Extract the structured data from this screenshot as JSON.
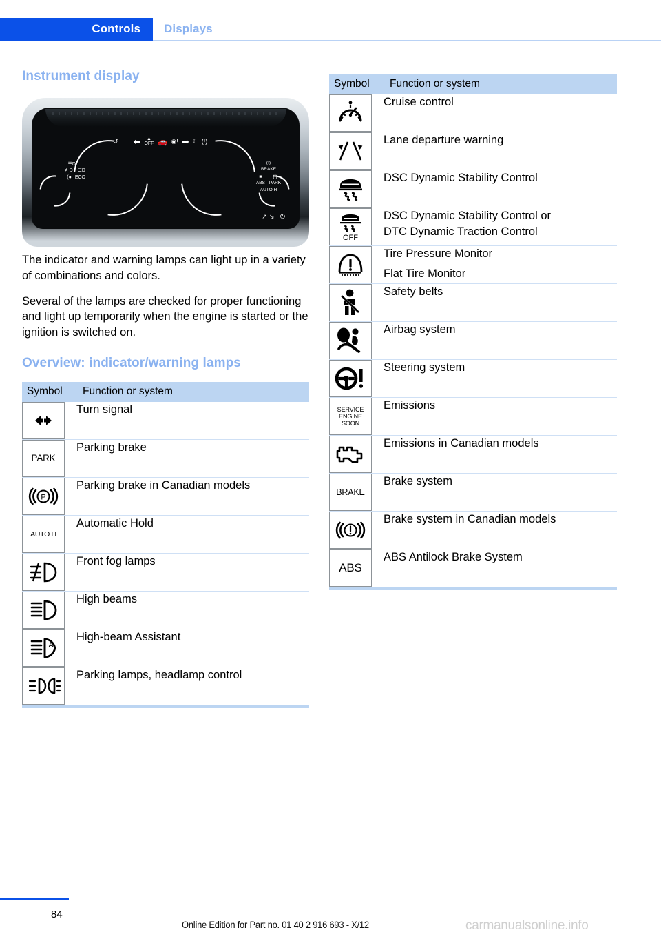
{
  "header": {
    "active_tab": "Controls",
    "inactive_tab": "Displays"
  },
  "left_column": {
    "section_title": "Instrument display",
    "figure_caption": "instrument-cluster-illustration",
    "paragraphs": [
      "The indicator and warning lamps can light up in a variety of combinations and colors.",
      "Several of the lamps are checked for proper functioning and light up temporarily when the engine is started or the ignition is switched on."
    ],
    "overview_title": "Overview: indicator/warning lamps",
    "table": {
      "headers": [
        "Symbol",
        "Function or system"
      ],
      "rows": [
        {
          "icon": "turn-signal-icon",
          "text": "Turn signal"
        },
        {
          "icon": "park-text-icon",
          "icon_text": "PARK",
          "text": "Parking brake"
        },
        {
          "icon": "parking-brake-canada-icon",
          "text": "Parking brake in Canadian models"
        },
        {
          "icon": "auto-hold-icon",
          "icon_text": "AUTO H",
          "text": "Automatic Hold"
        },
        {
          "icon": "front-fog-lamp-icon",
          "text": "Front fog lamps"
        },
        {
          "icon": "high-beam-icon",
          "text": "High beams"
        },
        {
          "icon": "high-beam-assistant-icon",
          "text": "High-beam Assistant"
        },
        {
          "icon": "parking-lamps-icon",
          "text": "Parking lamps, headlamp control"
        }
      ]
    }
  },
  "right_column": {
    "table": {
      "headers": [
        "Symbol",
        "Function or system"
      ],
      "rows": [
        {
          "icon": "cruise-control-icon",
          "text": "Cruise control"
        },
        {
          "icon": "lane-departure-warning-icon",
          "text": "Lane departure warning"
        },
        {
          "icon": "dsc-icon",
          "text": "DSC Dynamic Stability Control"
        },
        {
          "icon": "dsc-off-icon",
          "icon_text": "OFF",
          "text": "DSC Dynamic Stability Control or",
          "text2": "DTC Dynamic Traction Control"
        },
        {
          "icon": "tire-pressure-monitor-icon",
          "text": "Tire Pressure Monitor",
          "text2": "Flat Tire Monitor"
        },
        {
          "icon": "safety-belt-icon",
          "text": "Safety belts"
        },
        {
          "icon": "airbag-icon",
          "text": "Airbag system"
        },
        {
          "icon": "steering-system-icon",
          "text": "Steering system"
        },
        {
          "icon": "service-engine-soon-icon",
          "icon_text": "SERVICE ENGINE SOON",
          "text": "Emissions"
        },
        {
          "icon": "check-engine-icon",
          "text": "Emissions in Canadian models"
        },
        {
          "icon": "brake-text-icon",
          "icon_text": "BRAKE",
          "text": "Brake system"
        },
        {
          "icon": "brake-canada-icon",
          "text": "Brake system in Canadian models"
        },
        {
          "icon": "abs-text-icon",
          "icon_text": "ABS",
          "text": "ABS Antilock Brake System"
        }
      ]
    }
  },
  "footer": {
    "page_number": "84",
    "edition_text": "Online Edition for Part no. 01 40 2 916 693 - X/12",
    "watermark": "carmanualsonline.info"
  },
  "colors": {
    "accent_blue": "#0b51e8",
    "light_blue": "#8ab2f0",
    "table_header_bg": "#bcd5f2",
    "row_divider": "#cfe0f5"
  }
}
